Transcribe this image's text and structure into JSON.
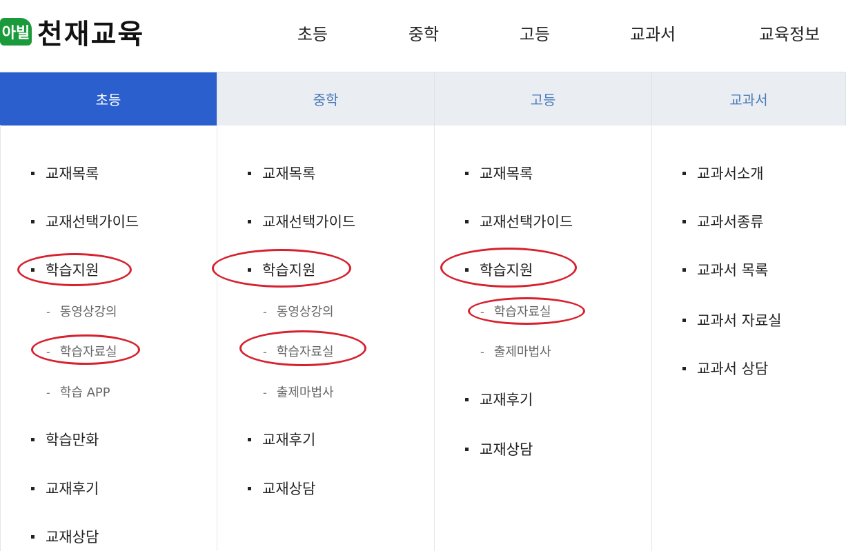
{
  "header": {
    "logo_mark": "아빌",
    "logo_text": "천재교육",
    "nav": [
      "초등",
      "중학",
      "고등",
      "교과서",
      "교육정보"
    ]
  },
  "tabs": [
    "초등",
    "중학",
    "고등",
    "교과서"
  ],
  "columns": [
    {
      "items": [
        {
          "label": "교재목록"
        },
        {
          "label": "교재선택가이드"
        },
        {
          "label": "학습지원",
          "subs": [
            "동영상강의",
            "학습자료실",
            "학습 APP"
          ]
        },
        {
          "label": "학습만화"
        },
        {
          "label": "교재후기"
        },
        {
          "label": "교재상담"
        }
      ]
    },
    {
      "items": [
        {
          "label": "교재목록"
        },
        {
          "label": "교재선택가이드"
        },
        {
          "label": "학습지원",
          "subs": [
            "동영상강의",
            "학습자료실",
            "출제마법사"
          ]
        },
        {
          "label": "교재후기"
        },
        {
          "label": "교재상담"
        }
      ]
    },
    {
      "items": [
        {
          "label": "교재목록"
        },
        {
          "label": "교재선택가이드"
        },
        {
          "label": "학습지원",
          "subs": [
            "학습자료실",
            "출제마법사"
          ]
        },
        {
          "label": "교재후기"
        },
        {
          "label": "교재상담"
        }
      ]
    },
    {
      "items": [
        {
          "label": "교과서소개"
        },
        {
          "label": "교과서종류"
        },
        {
          "label": "교과서 목록"
        },
        {
          "label": "교과서 자료실"
        },
        {
          "label": "교과서 상담"
        }
      ]
    }
  ],
  "colors": {
    "active_tab": "#2b5fce",
    "tab_bg": "#eaeef3",
    "highlight": "#d6212e"
  }
}
